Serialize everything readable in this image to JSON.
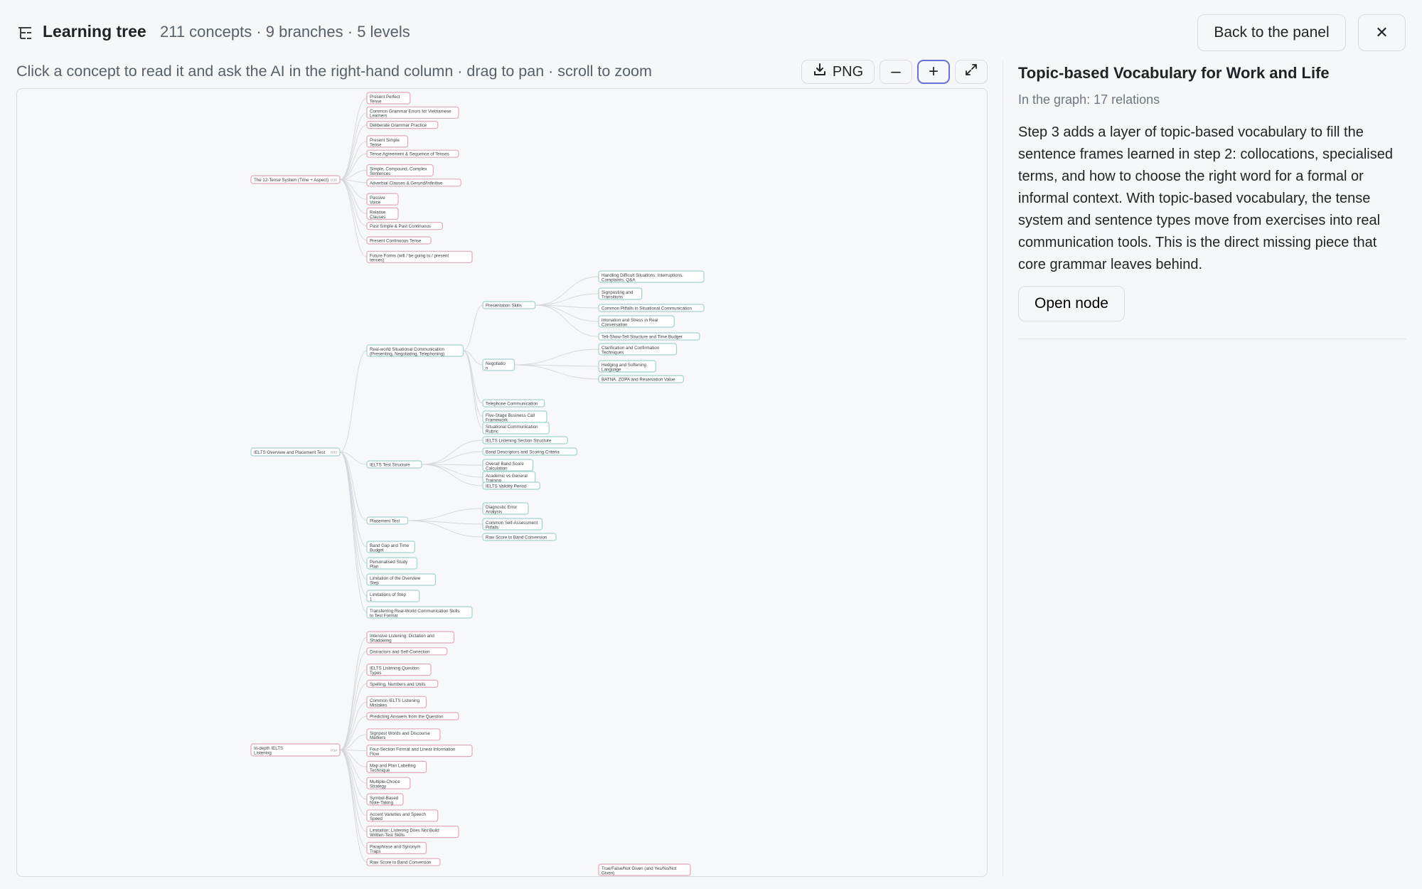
{
  "header": {
    "title": "Learning tree",
    "stats": "211 concepts · 9 branches · 5 levels",
    "back_label": "Back to the panel",
    "close_label": "✕"
  },
  "toolbar": {
    "hint": "Click a concept to read it and ask the AI in the right-hand column · drag to pan · scroll to zoom",
    "png_label": "PNG",
    "zoom_out_label": "–",
    "zoom_in_label": "+"
  },
  "panel": {
    "title": "Topic-based Vocabulary for Work and Life",
    "relations": "In the graph: 17 relations",
    "description": "Step 3 adds a layer of topic-based vocabulary to fill the sentence frames learned in step 2: collocations, specialised terms, and how to choose the right word for a formal or informal context. With topic-based vocabulary, the tense system and sentence types move from exercises into real communication tools. This is the direct missing piece that core grammar leaves behind.",
    "open_label": "Open node"
  },
  "colors": {
    "grammar": "#e0a9b8",
    "overview": "#9fd3cd",
    "listening": "#e0a9b8",
    "accent": "#6b6fd8"
  },
  "graph": {
    "branches": [
      {
        "id": "b1",
        "label": "The 12-Tense System (Time + Aspect)",
        "badge": "0/15",
        "color": "#e0a9b8",
        "children": [
          {
            "label": "Present Perfect\nTense"
          },
          {
            "label": "Common Grammar Errors for Vietnamese\nLearners"
          },
          {
            "label": "Deliberate Grammar Practice"
          },
          {
            "label": "Present Simple\nTense"
          },
          {
            "label": "Tense Agreement & Sequence of Tenses"
          },
          {
            "label": "Simple, Compound, Complex\nSentences"
          },
          {
            "label": "Adverbial Clauses & Gerund/Infinitive"
          },
          {
            "label": "Passive\nVoice"
          },
          {
            "label": "Relative\nClauses"
          },
          {
            "label": "Past Simple & Past Continuous"
          },
          {
            "label": "Present Continuous Tense"
          },
          {
            "label": "Future Forms (will / be going to / present\ntenses)"
          }
        ]
      },
      {
        "id": "b2",
        "label": "IELTS Overview and Placement Test",
        "badge": "0/33",
        "color": "#9fd3cd",
        "children": [
          {
            "label": "Real-world Situational Communication\n(Presenting, Negotiating, Telephoning)",
            "children": [
              {
                "label": "Presentation Skills",
                "children": [
                  {
                    "label": "Handling Difficult Situations: Interruptions,\nComplaints, Q&A"
                  },
                  {
                    "label": "Signposting and\nTransitions"
                  },
                  {
                    "label": "Common Pitfalls in Situational Communication"
                  },
                  {
                    "label": "Intonation and Stress in Real\nConversation"
                  },
                  {
                    "label": "Tell-Show-Tell Structure and Time Budget"
                  }
                ]
              },
              {
                "label": "Negotiatio\nn",
                "children": [
                  {
                    "label": "Clarification and Confirmation\nTechniques"
                  },
                  {
                    "label": "Hedging and Softening\nLanguage"
                  },
                  {
                    "label": "BATNA, ZOPA and Reservation Value"
                  }
                ]
              },
              {
                "label": "Telephone Communication"
              },
              {
                "label": "Five-Stage Business Call\nFramework"
              },
              {
                "label": "Situational Communication\nRubric"
              }
            ]
          },
          {
            "label": "IELTS Test Structure",
            "children": [
              {
                "label": "IELTS Listening Section Structure"
              },
              {
                "label": "Band Descriptors and Scoring Criteria"
              },
              {
                "label": "Overall Band Score\nCalculation"
              },
              {
                "label": "Academic vs General\nTraining"
              },
              {
                "label": "IELTS Validity Period"
              }
            ]
          },
          {
            "label": "Placement Test",
            "children": [
              {
                "label": "Diagnostic Error\nAnalysis"
              },
              {
                "label": "Common Self-Assessment\nPitfalls"
              },
              {
                "label": "Raw Score to Band Conversion"
              }
            ]
          },
          {
            "label": "Band Gap and Time\nBudget"
          },
          {
            "label": "Personalised Study\nPlan"
          },
          {
            "label": "Limitation of the Overview\nStep"
          },
          {
            "label": "Limitations of Step\n1"
          },
          {
            "label": "Transferring Real-World Communication Skills\nto Test Format"
          }
        ]
      },
      {
        "id": "b3",
        "label": "In-depth IELTS\nListening",
        "badge": "0/14",
        "color": "#e0a9b8",
        "children": [
          {
            "label": "Intensive Listening: Dictation and\nShadowing"
          },
          {
            "label": "Distractors and Self-Correction"
          },
          {
            "label": "IELTS Listening Question\nTypes"
          },
          {
            "label": "Spelling, Numbers and Units"
          },
          {
            "label": "Common IELTS Listening\nMistakes"
          },
          {
            "label": "Predicting Answers from the Question"
          },
          {
            "label": "Signpost Words and Discourse\nMarkers"
          },
          {
            "label": "Four-Section Format and Linear Information\nFlow"
          },
          {
            "label": "Map and Plan Labelling\nTechnique"
          },
          {
            "label": "Multiple-Choice\nStrategy"
          },
          {
            "label": "Symbol-Based\nNote-Taking"
          },
          {
            "label": "Accent Varieties and Speech\nSpeed"
          },
          {
            "label": "Limitation: Listening Does Not Build\nWritten-Test Skills"
          },
          {
            "label": "Paraphrase and Synonym\nTraps"
          },
          {
            "label": "Raw Score to Band Conversion"
          }
        ]
      }
    ],
    "orphan": {
      "label": "True/False/Not Given (and Yes/No/Not\nGiven)",
      "color": "#e0a9b8"
    }
  }
}
